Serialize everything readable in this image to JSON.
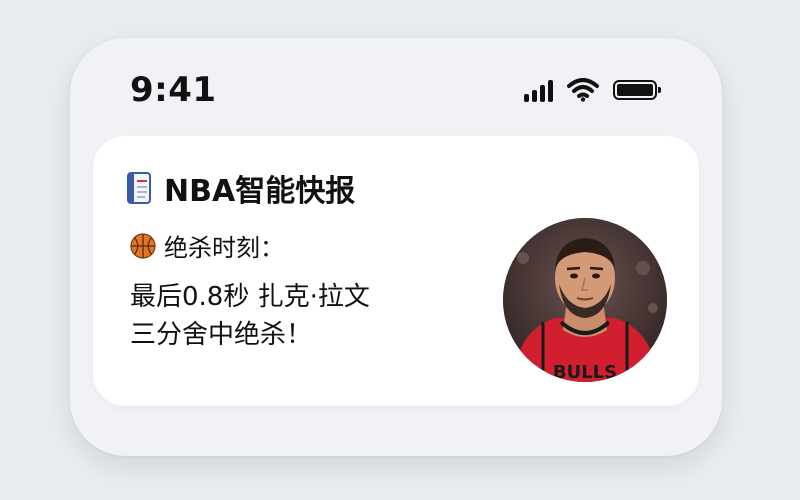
{
  "status_bar": {
    "time": "9:41",
    "icons": [
      "cellular-signal-icon",
      "wifi-icon",
      "battery-icon"
    ]
  },
  "notification": {
    "app_icon": "notepad-icon",
    "title": "NBA智能快报",
    "subtitle_icon": "basketball-icon",
    "subtitle": "绝杀时刻：",
    "body_lines": [
      "最后0.8秒  扎克·拉文",
      "三分舍中绝杀！"
    ],
    "avatar": "player-photo",
    "jersey_text": "BULLS"
  },
  "colors": {
    "background": "#e9ecf1",
    "phone": "#f1f2f5",
    "card": "#ffffff",
    "jersey_red": "#d21f2f",
    "text": "#111111"
  }
}
